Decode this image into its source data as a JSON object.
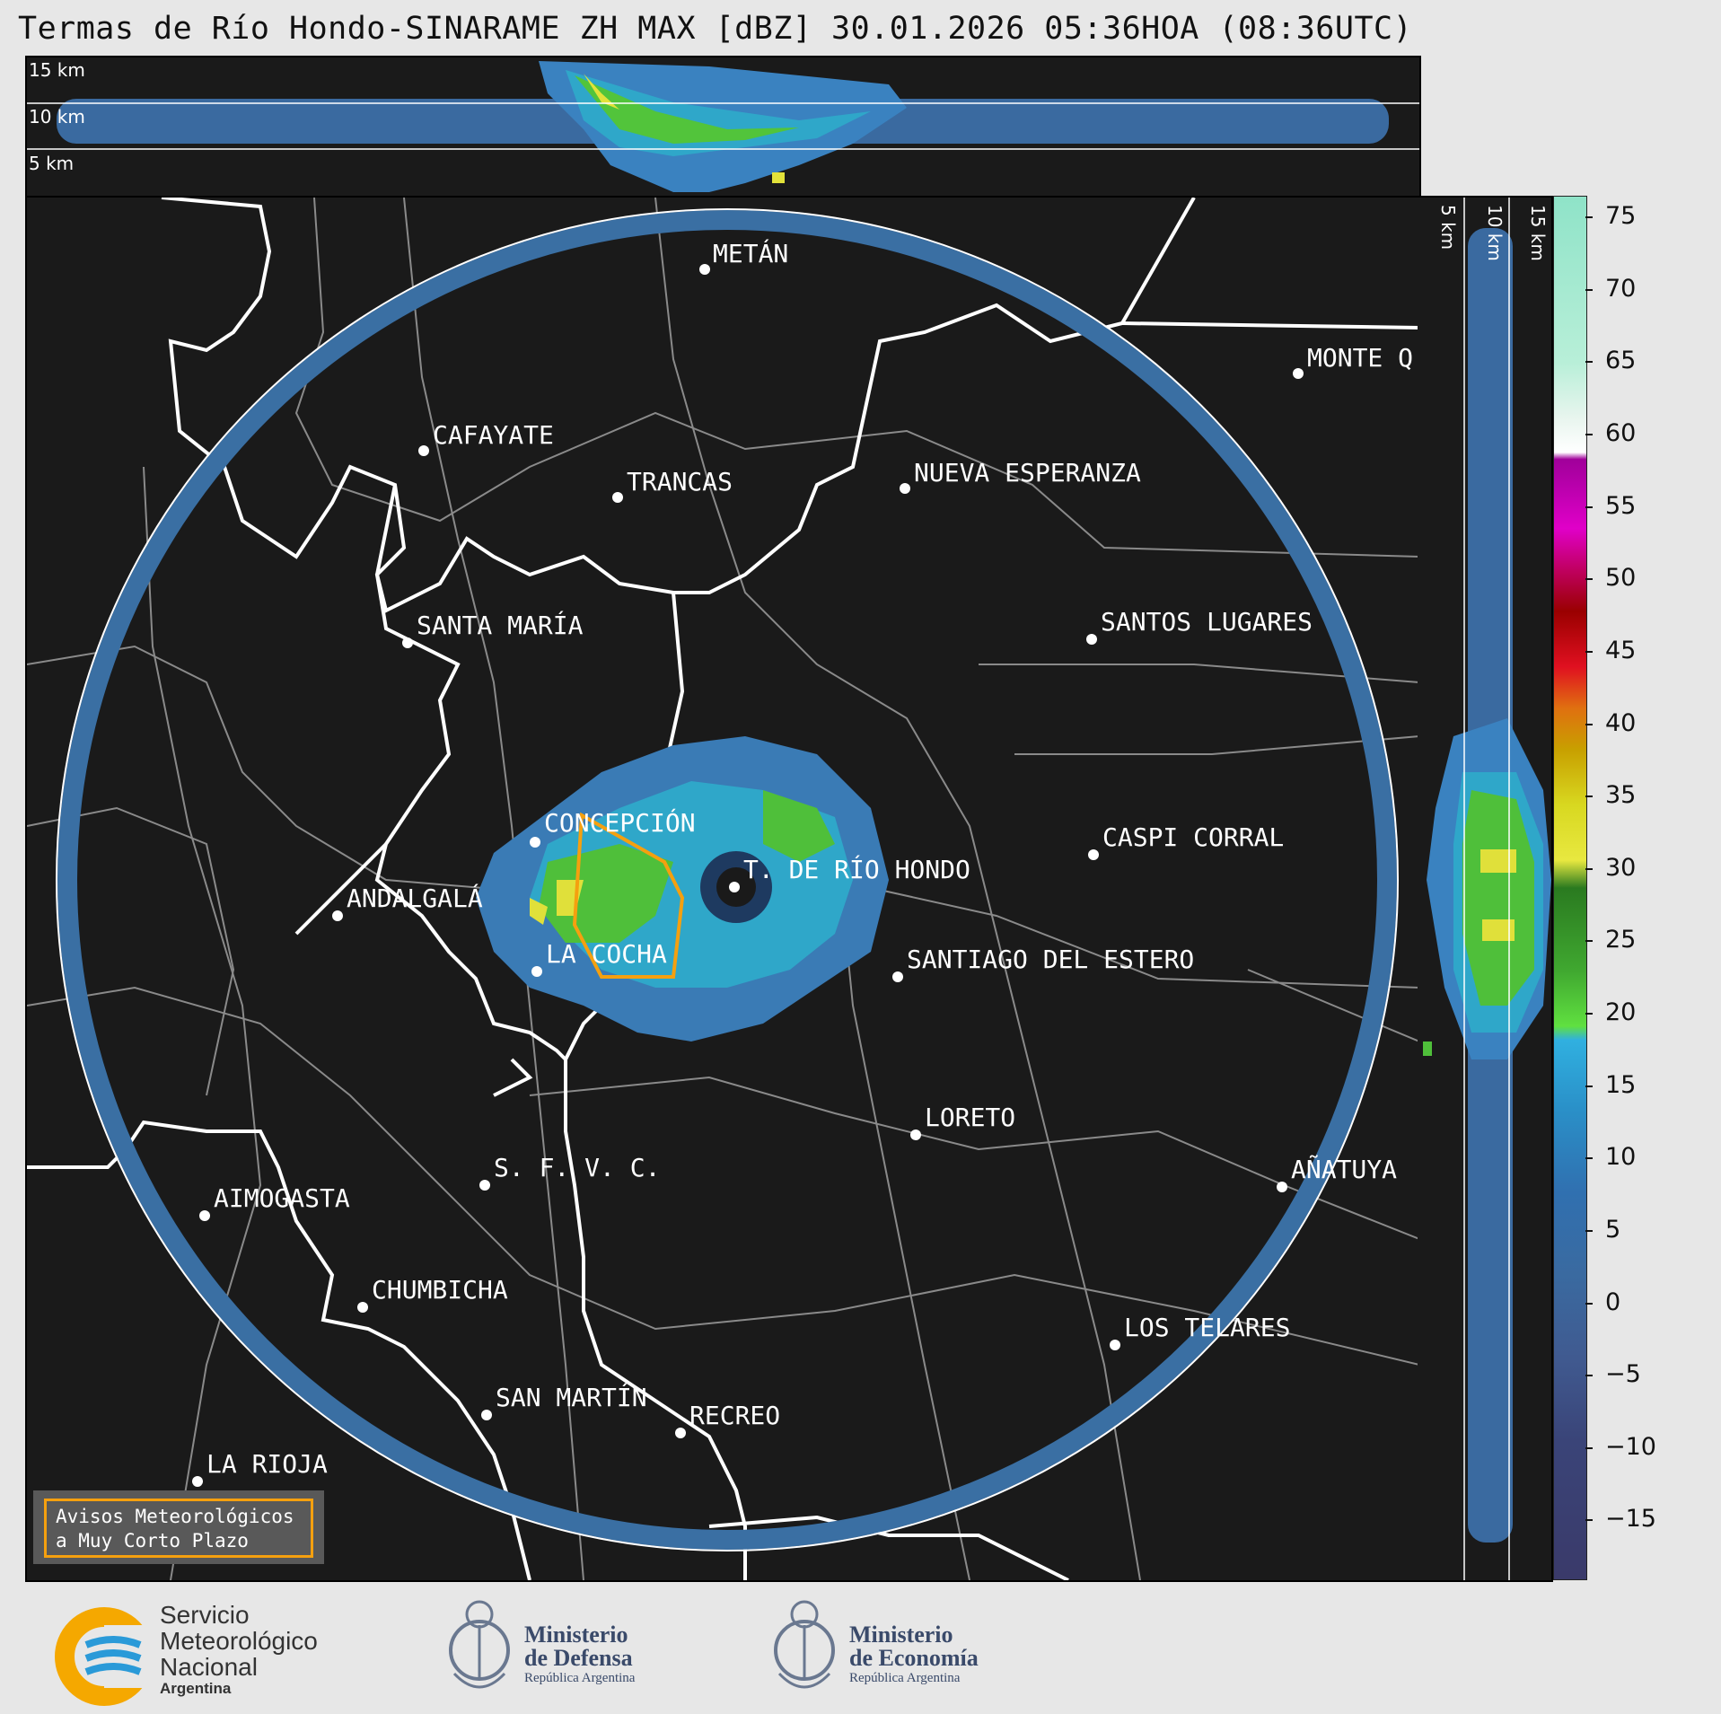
{
  "title": "Termas de Río Hondo-SINARAME ZH MAX [dBZ] 30.01.2026 05:36HOA (08:36UTC)",
  "top_section": {
    "labels": [
      "15 km",
      "10 km",
      "5 km"
    ]
  },
  "side_section": {
    "labels": [
      "5 km",
      "10 km",
      "15 km"
    ]
  },
  "colorbar": {
    "ticks": [
      "75",
      "70",
      "65",
      "60",
      "55",
      "50",
      "45",
      "40",
      "35",
      "30",
      "25",
      "20",
      "15",
      "10",
      "5",
      "0",
      "−5",
      "−10",
      "−15"
    ],
    "min": -19,
    "max": 76.5
  },
  "cities": [
    {
      "name": "METÁN"
    },
    {
      "name": "MONTE Q"
    },
    {
      "name": "CAFAYATE"
    },
    {
      "name": "TRANCAS"
    },
    {
      "name": "NUEVA ESPERANZA"
    },
    {
      "name": "SANTA MARÍA"
    },
    {
      "name": "SANTOS LUGARES"
    },
    {
      "name": "CONCEPCIÓN"
    },
    {
      "name": "T. DE RÍO HONDO"
    },
    {
      "name": "CASPI CORRAL"
    },
    {
      "name": "ANDALGALÁ"
    },
    {
      "name": "LA COCHA"
    },
    {
      "name": "SANTIAGO DEL ESTERO"
    },
    {
      "name": "LORETO"
    },
    {
      "name": "S. F. V. C."
    },
    {
      "name": "AIMOGASTA"
    },
    {
      "name": "AÑATUYA"
    },
    {
      "name": "CHUMBICHA"
    },
    {
      "name": "LOS TELARES"
    },
    {
      "name": "SAN MARTÍN"
    },
    {
      "name": "RECREO"
    },
    {
      "name": "LA RIOJA"
    }
  ],
  "warning_box": {
    "line1": "Avisos Meteorológicos",
    "line2": "a Muy Corto Plazo"
  },
  "footer": {
    "smn": {
      "line1": "Servicio",
      "line2": "Meteorológico",
      "line3": "Nacional",
      "line4": "Argentina"
    },
    "defensa": {
      "line1": "Ministerio",
      "line2": "de Defensa",
      "line3": "República Argentina"
    },
    "economia": {
      "line1": "Ministerio",
      "line2": "de Economía",
      "line3": "República Argentina"
    }
  },
  "colors": {
    "warning_outline": "#f5a00f",
    "range_ring": "#3a6fa3",
    "echo_weak": "#3a7bb5",
    "echo_mod": "#4fbf3a",
    "echo_strong": "#e0e03a"
  }
}
